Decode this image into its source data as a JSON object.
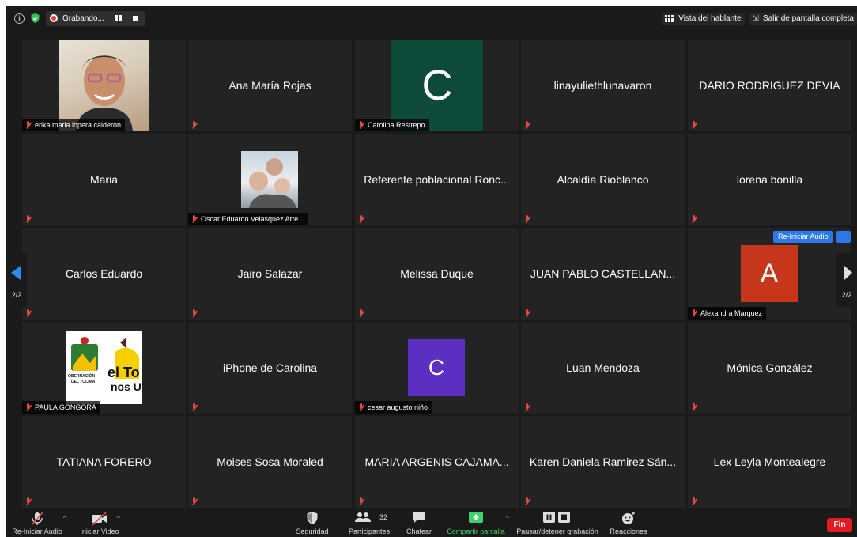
{
  "top_bar": {
    "recording_label": "Grabando...",
    "speaker_view_label": "Vista del hablante",
    "exit_fullscreen_label": "Salir de pantalla completa"
  },
  "pagination": {
    "left_page": "2/2",
    "right_page": "2/2"
  },
  "participants": [
    {
      "name": "erika maria lopera calderon",
      "video": "photo",
      "label_position": "footer"
    },
    {
      "name": "Ana María Rojas",
      "video": "off",
      "label_position": "center"
    },
    {
      "name": "Carolina Restrepo",
      "video": "avatar",
      "avatar_letter": "C",
      "avatar_color": "#0d4a3a",
      "label_position": "footer"
    },
    {
      "name": "linayuliethlunavaron",
      "video": "off",
      "label_position": "center"
    },
    {
      "name": "DARIO RODRIGUEZ DEVIA",
      "video": "off",
      "label_position": "center"
    },
    {
      "name": "Maria",
      "video": "off",
      "label_position": "center"
    },
    {
      "name": "Oscar Eduardo Velasquez Arte...",
      "video": "photo",
      "label_position": "footer"
    },
    {
      "name": "Referente poblacional Ronc...",
      "video": "off",
      "label_position": "center"
    },
    {
      "name": "Alcaldía Rioblanco",
      "video": "off",
      "label_position": "center"
    },
    {
      "name": "lorena bonilla",
      "video": "off",
      "label_position": "center"
    },
    {
      "name": "Carlos Eduardo",
      "video": "off",
      "label_position": "center"
    },
    {
      "name": "Jairo Salazar",
      "video": "off",
      "label_position": "center"
    },
    {
      "name": "Melissa Duque",
      "video": "off",
      "label_position": "center"
    },
    {
      "name": "JUAN PABLO CASTELLAN...",
      "video": "off",
      "label_position": "center"
    },
    {
      "name": "Alexandra Marquez",
      "video": "avatar",
      "avatar_letter": "A",
      "avatar_color": "#c5361a",
      "label_position": "footer"
    },
    {
      "name": "PAULA GONGORA",
      "video": "logo",
      "label_position": "footer",
      "logo_text": [
        "OBERNACIÓN",
        "DEL TOLIMA",
        "el To",
        "nos U"
      ]
    },
    {
      "name": "iPhone de Carolina",
      "video": "off",
      "label_position": "center"
    },
    {
      "name": "cesar augusto niño",
      "video": "avatar",
      "avatar_letter": "C",
      "avatar_color": "#5a2fc2",
      "label_position": "footer"
    },
    {
      "name": "Luan Mendoza",
      "video": "off",
      "label_position": "center"
    },
    {
      "name": "Mónica González",
      "video": "off",
      "label_position": "center"
    },
    {
      "name": "TATIANA FORERO",
      "video": "off",
      "label_position": "center"
    },
    {
      "name": "Moises Sosa Moraled",
      "video": "off",
      "label_position": "center"
    },
    {
      "name": "MARIA ARGENIS CAJAMA...",
      "video": "off",
      "label_position": "center"
    },
    {
      "name": "Karen Daniela Ramirez Sán...",
      "video": "off",
      "label_position": "center"
    },
    {
      "name": "Lex Leyla Montealegre",
      "video": "off",
      "label_position": "center"
    }
  ],
  "hover_controls": {
    "reiniciar_audio": "Re-Iniciar Audio",
    "more": "···"
  },
  "toolbar": {
    "audio_label": "Re-Iniciar Audio",
    "video_label": "Iniciar Video",
    "security_label": "Seguridad",
    "participants_label": "Participantes",
    "participants_count": "32",
    "chat_label": "Chatear",
    "share_label": "Compartir pantalla",
    "pause_record_label": "Pausar/detener grabación",
    "reactions_label": "Reacciones",
    "end_label": "Fin"
  },
  "colors": {
    "share_green": "#3fd26b",
    "end_red": "#e21b23",
    "accent_blue": "#2d78e8"
  }
}
